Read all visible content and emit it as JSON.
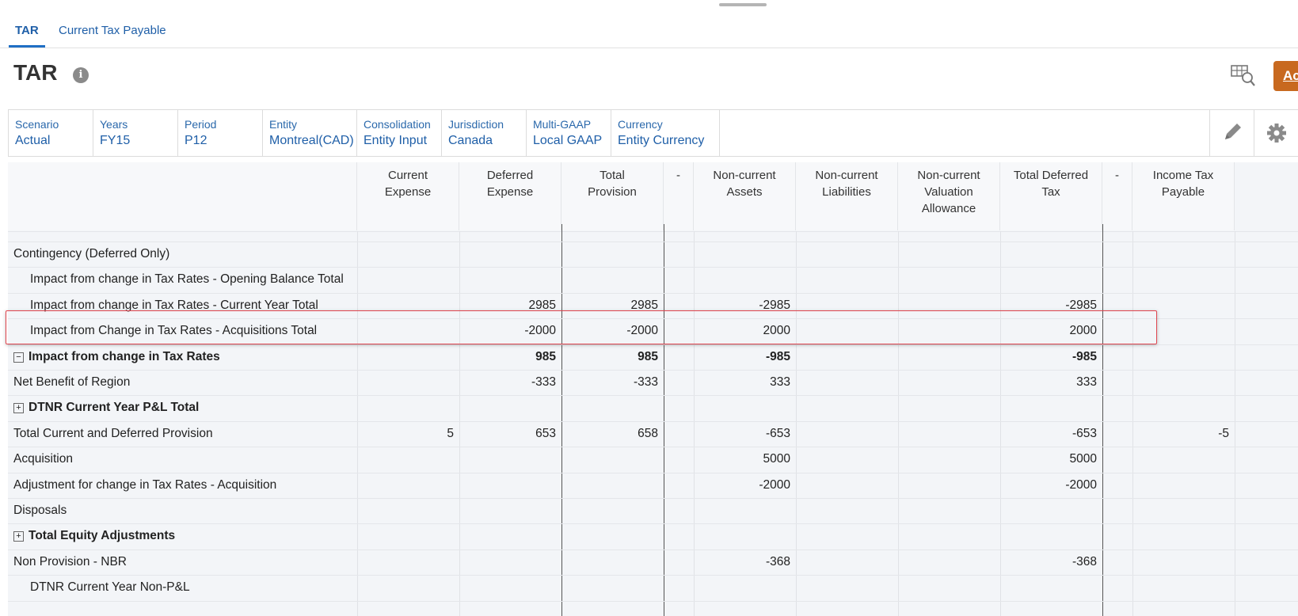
{
  "tabs": [
    {
      "label": "TAR",
      "active": true
    },
    {
      "label": "Current Tax Payable",
      "active": false
    }
  ],
  "page_title": "TAR",
  "action_button_label": "Ac",
  "pov": [
    {
      "label": "Scenario",
      "value": "Actual"
    },
    {
      "label": "Years",
      "value": "FY15"
    },
    {
      "label": "Period",
      "value": "P12"
    },
    {
      "label": "Entity",
      "value": "Montreal(CAD)"
    },
    {
      "label": "Consolidation",
      "value": "Entity Input"
    },
    {
      "label": "Jurisdiction",
      "value": "Canada"
    },
    {
      "label": "Multi-GAAP",
      "value": "Local GAAP"
    },
    {
      "label": "Currency",
      "value": "Entity Currency"
    }
  ],
  "columns": [
    [
      "Current",
      "Expense"
    ],
    [
      "Deferred",
      "Expense"
    ],
    [
      "Total",
      "Provision"
    ],
    [
      "-"
    ],
    [
      "Non-current",
      "Assets"
    ],
    [
      "Non-current",
      "Liabilities"
    ],
    [
      "Non-current",
      "Valuation",
      "Allowance"
    ],
    [
      "Total Deferred",
      "Tax"
    ],
    [
      "-"
    ],
    [
      "Income Tax",
      "Payable"
    ]
  ],
  "rows": [
    {
      "label": "Contingency (Deferred Only)",
      "indent": 0,
      "bold": false,
      "expander": "",
      "values": [
        "",
        "",
        "",
        "",
        "",
        "",
        "",
        "",
        "",
        ""
      ]
    },
    {
      "label": "Impact from change in Tax Rates - Opening Balance Total",
      "indent": 1,
      "bold": false,
      "expander": "",
      "values": [
        "",
        "",
        "",
        "",
        "",
        "",
        "",
        "",
        "",
        ""
      ]
    },
    {
      "label": "Impact from change in Tax Rates - Current Year Total",
      "indent": 1,
      "bold": false,
      "expander": "",
      "values": [
        "",
        "2985",
        "2985",
        "",
        "-2985",
        "",
        "",
        "-2985",
        "",
        ""
      ]
    },
    {
      "label": "Impact from Change in Tax Rates - Acquisitions Total",
      "indent": 1,
      "bold": false,
      "expander": "",
      "highlighted": true,
      "values": [
        "",
        "-2000",
        "-2000",
        "",
        "2000",
        "",
        "",
        "2000",
        "",
        ""
      ]
    },
    {
      "label": "Impact from change in Tax Rates",
      "indent": 0,
      "bold": true,
      "expander": "−",
      "values": [
        "",
        "985",
        "985",
        "",
        "-985",
        "",
        "",
        "-985",
        "",
        ""
      ]
    },
    {
      "label": "Net Benefit of Region",
      "indent": 0,
      "bold": false,
      "expander": "",
      "values": [
        "",
        "-333",
        "-333",
        "",
        "333",
        "",
        "",
        "333",
        "",
        ""
      ]
    },
    {
      "label": "DTNR Current Year P&L Total",
      "indent": 0,
      "bold": true,
      "expander": "+",
      "values": [
        "",
        "",
        "",
        "",
        "",
        "",
        "",
        "",
        "",
        ""
      ]
    },
    {
      "label": "Total Current and Deferred Provision",
      "indent": 0,
      "bold": false,
      "expander": "",
      "values": [
        "5",
        "653",
        "658",
        "",
        "-653",
        "",
        "",
        "-653",
        "",
        "-5"
      ]
    },
    {
      "label": "Acquisition",
      "indent": 0,
      "bold": false,
      "expander": "",
      "values": [
        "",
        "",
        "",
        "",
        "5000",
        "",
        "",
        "5000",
        "",
        ""
      ]
    },
    {
      "label": "Adjustment for change in Tax Rates - Acquisition",
      "indent": 0,
      "bold": false,
      "expander": "",
      "values": [
        "",
        "",
        "",
        "",
        "-2000",
        "",
        "",
        "-2000",
        "",
        ""
      ]
    },
    {
      "label": "Disposals",
      "indent": 0,
      "bold": false,
      "expander": "",
      "values": [
        "",
        "",
        "",
        "",
        "",
        "",
        "",
        "",
        "",
        ""
      ]
    },
    {
      "label": "Total Equity Adjustments",
      "indent": 0,
      "bold": true,
      "expander": "+",
      "values": [
        "",
        "",
        "",
        "",
        "",
        "",
        "",
        "",
        "",
        ""
      ]
    },
    {
      "label": "Non Provision - NBR",
      "indent": 0,
      "bold": false,
      "expander": "",
      "values": [
        "",
        "",
        "",
        "",
        "-368",
        "",
        "",
        "-368",
        "",
        ""
      ]
    },
    {
      "label": "DTNR Current Year Non-P&L",
      "indent": 1,
      "bold": false,
      "expander": "",
      "values": [
        "",
        "",
        "",
        "",
        "",
        "",
        "",
        "",
        "",
        ""
      ]
    }
  ]
}
